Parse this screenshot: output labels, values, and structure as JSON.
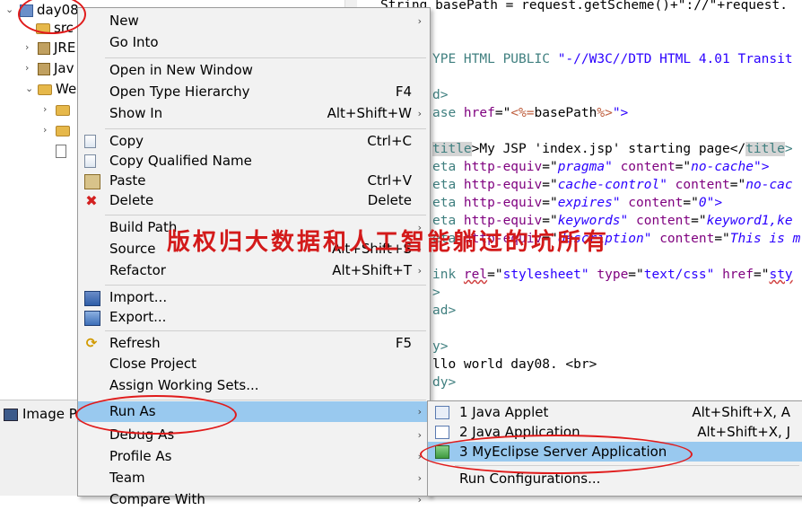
{
  "tree": {
    "project": "day08",
    "items": [
      "src",
      "JRE",
      "Jav",
      "We"
    ]
  },
  "image_preview": {
    "tab_label": "Image Pr"
  },
  "editor": {
    "lines": {
      "l0a": "String basePath = request.getScheme()+\"://\"+request.",
      "l1a": "YPE HTML PUBLIC ",
      "l1b": "\"-//W3C//DTD HTML 4.01 Transit",
      "l2a": "d>",
      "l3a": "ase ",
      "l3b": "href",
      "l3c": "=\"",
      "l3d": "<%=",
      "l3e": "basePath",
      "l3f": "%>",
      "l3g": "\">",
      "l4a": "title",
      "l4b": ">My JSP 'index.jsp' starting page</",
      "l4c": "title",
      "l4d": ">",
      "l5a": "eta ",
      "l5b": "http-equiv",
      "l5c": "=\"",
      "l5d": "pragma",
      "l5e": "\" ",
      "l5f": "content",
      "l5g": "=\"",
      "l5h": "no-cache",
      "l5i": "\">",
      "l6a": "eta ",
      "l6b": "http-equiv",
      "l6c": "=\"",
      "l6d": "cache-control",
      "l6e": "\" ",
      "l6f": "content",
      "l6g": "=\"",
      "l6h": "no-cac",
      "l7a": "eta ",
      "l7b": "http-equiv",
      "l7c": "=\"",
      "l7d": "expires",
      "l7e": "\" ",
      "l7f": "content",
      "l7g": "=\"",
      "l7h": "0",
      "l7i": "\">",
      "l8a": "eta ",
      "l8b": "http-equiv",
      "l8c": "=\"",
      "l8d": "keywords",
      "l8e": "\" ",
      "l8f": "content",
      "l8g": "=\"",
      "l8h": "keyword1,ke",
      "l9a": "eta ",
      "l9b": "http-equiv",
      "l9c": "=\"",
      "l9d": "description",
      "l9e": "\" ",
      "l9f": "content",
      "l9g": "=\"",
      "l9h": "This is m",
      "l10a": "ink ",
      "l10b": "rel",
      "l10c": "=\"",
      "l10d": "stylesheet",
      "l10e": "\" ",
      "l10f": "type",
      "l10g": "=\"",
      "l10h": "text/css",
      "l10i": "\" ",
      "l10j": "href",
      "l10k": "=\"",
      "l10l": "sty",
      "l11a": ">",
      "l12a": "ad>",
      "l13a": "y>",
      "l14a": "llo world day08. <br>",
      "l15a": "dy>"
    }
  },
  "watermark": "版权归大数据和人工智能躺过的坑所有",
  "context_menu": {
    "new": "New",
    "go_into": "Go Into",
    "open_new_window": "Open in New Window",
    "open_type_hierarchy": "Open Type Hierarchy",
    "open_type_hierarchy_acc": "F4",
    "show_in": "Show In",
    "show_in_acc": "Alt+Shift+W",
    "copy": "Copy",
    "copy_acc": "Ctrl+C",
    "copy_qualified": "Copy Qualified Name",
    "paste": "Paste",
    "paste_acc": "Ctrl+V",
    "delete": "Delete",
    "delete_acc": "Delete",
    "build_path": "Build Path",
    "source": "Source",
    "source_acc": "Alt+Shift+S",
    "refactor": "Refactor",
    "refactor_acc": "Alt+Shift+T",
    "import": "Import...",
    "export": "Export...",
    "refresh": "Refresh",
    "refresh_acc": "F5",
    "close_project": "Close Project",
    "assign_working_sets": "Assign Working Sets...",
    "run_as": "Run As",
    "debug_as": "Debug As",
    "profile_as": "Profile As",
    "team": "Team",
    "compare_with": "Compare With"
  },
  "submenu": {
    "java_applet": "1 Java Applet",
    "java_applet_acc": "Alt+Shift+X, A",
    "java_application": "2 Java Application",
    "java_application_acc": "Alt+Shift+X, J",
    "server_application": "3 MyEclipse Server Application",
    "run_configurations": "Run Configurations..."
  },
  "colors": {
    "menu_bg": "#f2f2f2",
    "selection": "#99c9ef",
    "annotation_red": "#e01b1b"
  }
}
